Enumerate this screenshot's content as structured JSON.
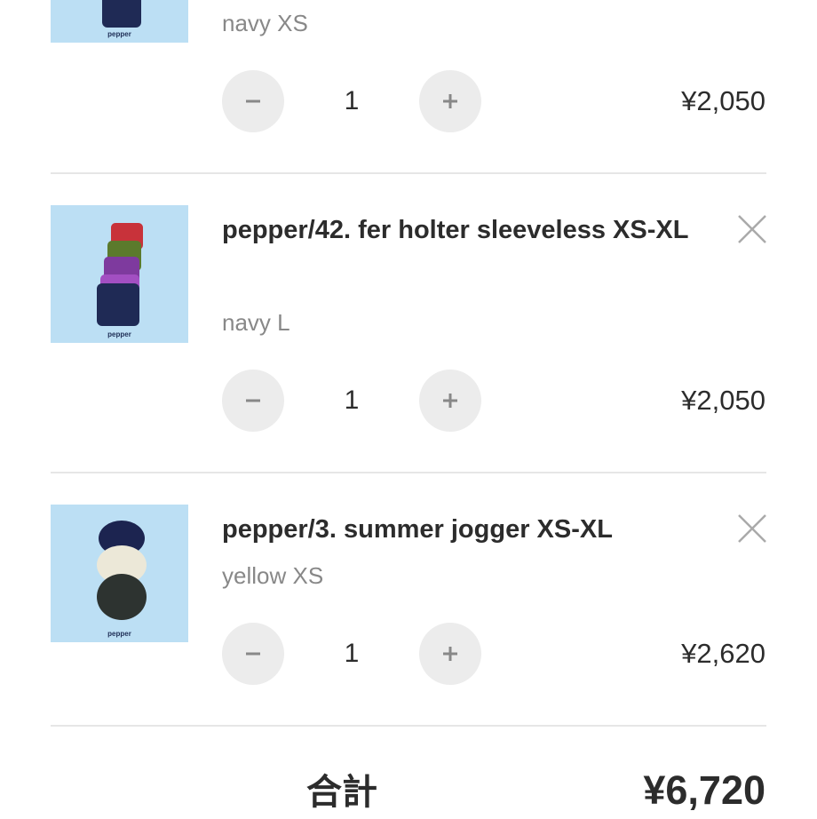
{
  "cart": {
    "items": [
      {
        "title": "",
        "variant": "navy XS",
        "quantity": "1",
        "price": "¥2,050",
        "thumb_label": "pepper"
      },
      {
        "title": "pepper/42. fer holter sleeveless XS-XL",
        "variant": "navy L",
        "quantity": "1",
        "price": "¥2,050",
        "thumb_label": "pepper"
      },
      {
        "title": "pepper/3. summer jogger XS-XL",
        "variant": "yellow XS",
        "quantity": "1",
        "price": "¥2,620",
        "thumb_label": "pepper"
      }
    ],
    "total_label": "合計",
    "total_value": "¥6,720"
  },
  "icons": {
    "remove": "close-icon",
    "decrement": "minus-icon",
    "increment": "plus-icon"
  },
  "colors": {
    "thumb_background": "#bcdff4",
    "button_background": "#ececec",
    "variant_text": "#888888",
    "divider": "#e6e6e6"
  }
}
